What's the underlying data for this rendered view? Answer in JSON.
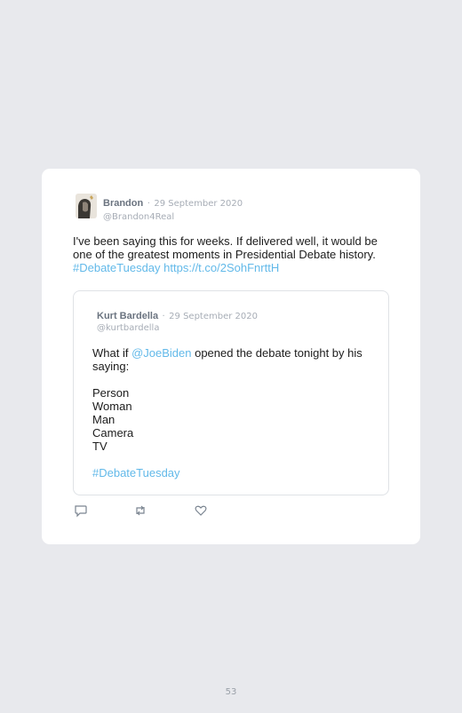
{
  "tweet": {
    "author_name": "Brandon",
    "separator": "·",
    "date": "29 September 2020",
    "handle": "@Brandon4Real",
    "text_line1": "I've been saying this for weeks. If delivered well, it would be",
    "text_line2": "one of the greatest moments in Presidential Debate history.",
    "hashtag": "#DebateTuesday",
    "url": "https://t.co/2SohFnrttH"
  },
  "quoted_tweet": {
    "author_name": "Kurt Bardella",
    "separator": "·",
    "date": "29 September 2020",
    "handle": "@kurtbardella",
    "intro_before": "What if ",
    "mention": "@JoeBiden",
    "intro_after": " opened the debate tonight by his saying:",
    "lines": [
      "Person",
      "Woman",
      "Man",
      "Camera",
      "TV"
    ],
    "hashtag": "#DebateTuesday"
  },
  "actions": [
    "reply-icon",
    "retweet-icon",
    "like-icon"
  ],
  "page_number": "53",
  "colors": {
    "background": "#e8e9ed",
    "card": "#ffffff",
    "link": "#62b9e9",
    "muted": "#a7adb6"
  }
}
